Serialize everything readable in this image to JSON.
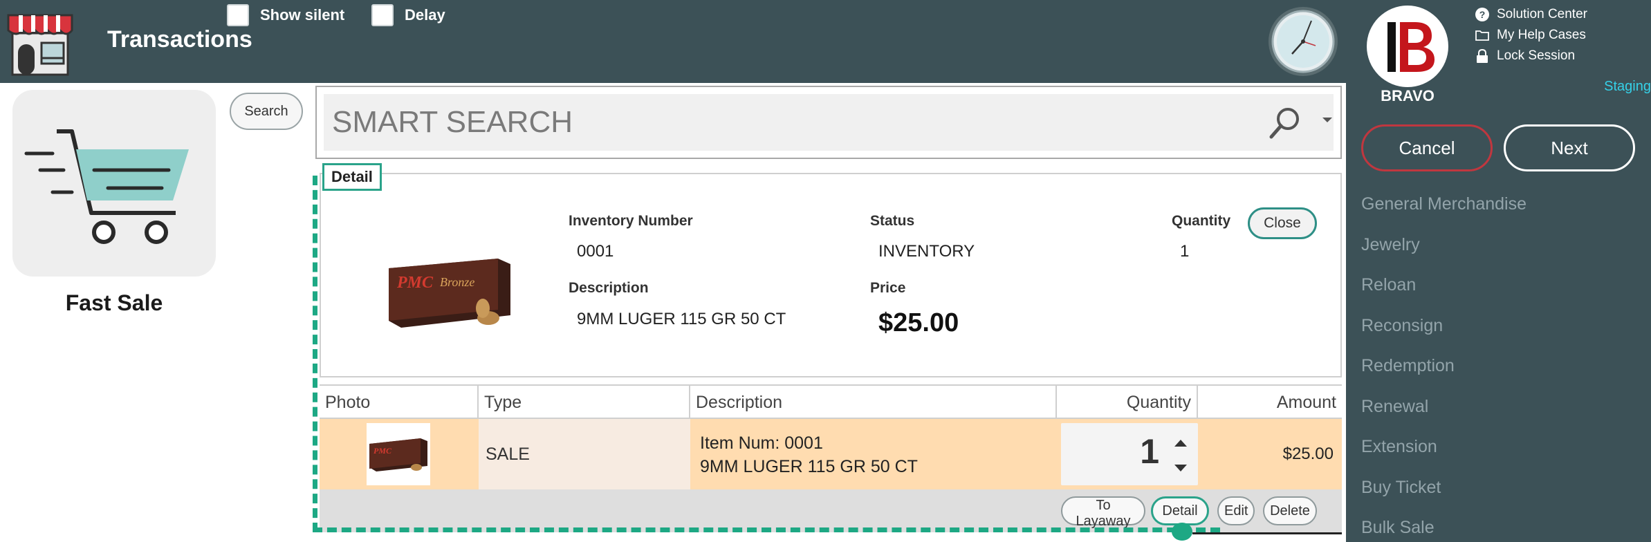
{
  "header": {
    "title": "Transactions",
    "show_silent_label": "Show silent",
    "delay_label": "Delay"
  },
  "right_panel": {
    "brand": "BRAVO",
    "help_links": [
      "Solution Center",
      "My Help Cases",
      "Lock Session"
    ],
    "environment": "Staging",
    "cancel_label": "Cancel",
    "next_label": "Next",
    "menu_items": [
      "General Merchandise",
      "Jewelry",
      "Reloan",
      "Reconsign",
      "Redemption",
      "Renewal",
      "Extension",
      "Buy Ticket",
      "Bulk Sale"
    ]
  },
  "left_panel": {
    "fast_sale_label": "Fast Sale",
    "search_label": "Search"
  },
  "smart_search": {
    "placeholder": "SMART SEARCH"
  },
  "detail": {
    "legend": "Detail",
    "inventory_number_label": "Inventory Number",
    "inventory_number": "0001",
    "status_label": "Status",
    "status": "INVENTORY",
    "quantity_label": "Quantity",
    "quantity": "1",
    "description_label": "Description",
    "description": "9MM LUGER 115 GR 50 CT",
    "price_label": "Price",
    "price": "$25.00",
    "close_label": "Close"
  },
  "table": {
    "headers": [
      "Photo",
      "Type",
      "Description",
      "Quantity",
      "Amount"
    ],
    "rows": [
      {
        "type": "SALE",
        "item_num": "Item Num: 0001",
        "description": "9MM LUGER 115 GR 50 CT",
        "quantity": "1",
        "amount": "$25.00"
      }
    ],
    "actions": [
      "To Layaway",
      "Detail",
      "Edit",
      "Delete"
    ]
  },
  "colors": {
    "header_bg": "#3c5157",
    "accent_green": "#1da884",
    "cancel_red": "#c0373f",
    "row_highlight": "#ffdcb0",
    "staging_cyan": "#35d1e8"
  }
}
